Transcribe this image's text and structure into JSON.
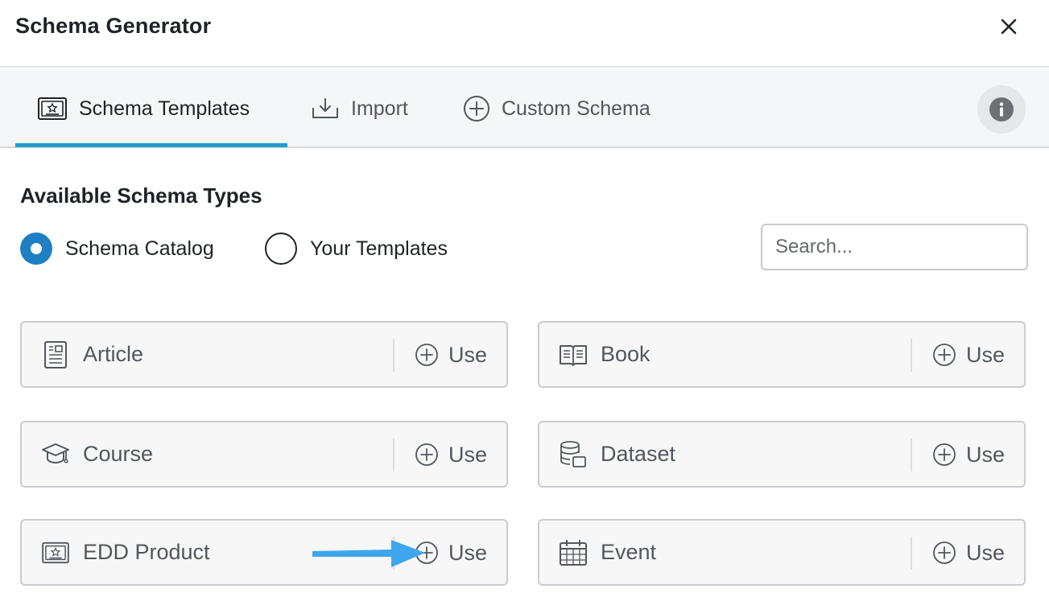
{
  "modal": {
    "title": "Schema Generator"
  },
  "tabs": [
    {
      "label": "Schema Templates",
      "icon": "certificate-icon",
      "active": true
    },
    {
      "label": "Import",
      "icon": "import-icon",
      "active": false
    },
    {
      "label": "Custom Schema",
      "icon": "plus-circle-icon",
      "active": false
    }
  ],
  "section": {
    "title": "Available Schema Types"
  },
  "radios": [
    {
      "label": "Schema Catalog",
      "checked": true
    },
    {
      "label": "Your Templates",
      "checked": false
    }
  ],
  "search": {
    "placeholder": "Search...",
    "value": ""
  },
  "cards": [
    {
      "label": "Article",
      "icon": "article-icon",
      "use_label": "Use"
    },
    {
      "label": "Book",
      "icon": "book-icon",
      "use_label": "Use"
    },
    {
      "label": "Course",
      "icon": "graduation-cap-icon",
      "use_label": "Use"
    },
    {
      "label": "Dataset",
      "icon": "database-icon",
      "use_label": "Use"
    },
    {
      "label": "EDD Product",
      "icon": "certificate-icon",
      "use_label": "Use"
    },
    {
      "label": "Event",
      "icon": "calendar-icon",
      "use_label": "Use"
    }
  ],
  "colors": {
    "accent": "#1e9ec8",
    "radio_on": "#1e7fc2",
    "annotation_arrow": "#3ea6ee"
  }
}
